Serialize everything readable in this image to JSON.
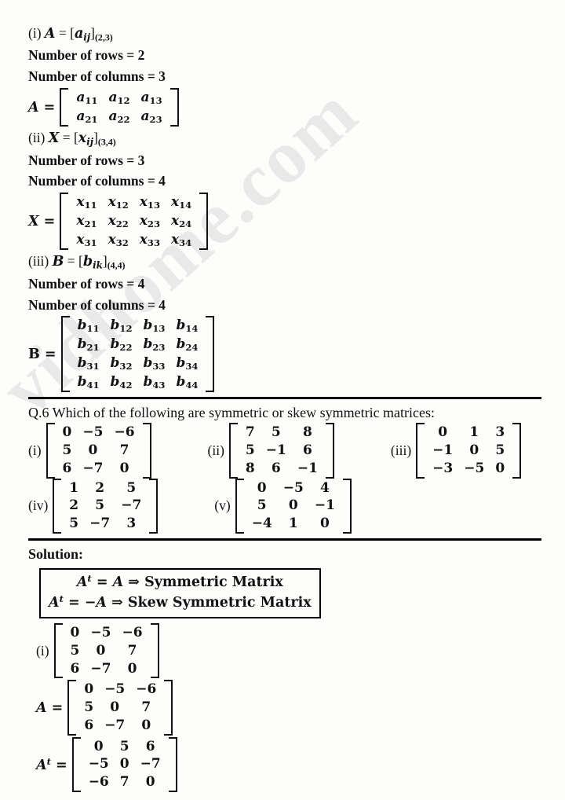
{
  "document": {
    "type": "math-worksheet-page",
    "watermark_text": "vidhome.com"
  },
  "part_i": {
    "label": "(i)",
    "definition_var": "A",
    "definition_eq": "=",
    "entry_symbol": "a",
    "entry_sub": "ij",
    "order": "(2,3)",
    "rows_text": "Number of rows = 2",
    "cols_text": "Number of columns = 3",
    "matrix_label": "A",
    "matrix": {
      "rows": 2,
      "cols": 3,
      "cells": [
        [
          "a",
          "a",
          "a"
        ],
        [
          "a",
          "a",
          "a"
        ]
      ],
      "subs": [
        [
          "11",
          "12",
          "13"
        ],
        [
          "21",
          "22",
          "23"
        ]
      ]
    }
  },
  "part_ii": {
    "label": "(ii)",
    "definition_var": "X",
    "entry_symbol": "x",
    "entry_sub": "ij",
    "order": "(3,4)",
    "rows_text": "Number of rows = 3",
    "cols_text": "Number of columns = 4",
    "matrix_label": "X",
    "matrix": {
      "rows": 3,
      "cols": 4,
      "cells": [
        [
          "x",
          "x",
          "x",
          "x"
        ],
        [
          "x",
          "x",
          "x",
          "x"
        ],
        [
          "x",
          "x",
          "x",
          "x"
        ]
      ],
      "subs": [
        [
          "11",
          "12",
          "13",
          "14"
        ],
        [
          "21",
          "22",
          "23",
          "24"
        ],
        [
          "31",
          "32",
          "33",
          "34"
        ]
      ]
    }
  },
  "part_iii": {
    "label": "(iii)",
    "definition_var": "B",
    "entry_symbol": "b",
    "entry_sub": "ik",
    "order": "(4,4)",
    "rows_text": "Number of rows = 4",
    "cols_text": "Number of columns = 4",
    "matrix_label": "B",
    "matrix": {
      "rows": 4,
      "cols": 4,
      "cells": [
        [
          "b",
          "b",
          "b",
          "b"
        ],
        [
          "b",
          "b",
          "b",
          "b"
        ],
        [
          "b",
          "b",
          "b",
          "b"
        ],
        [
          "b",
          "b",
          "b",
          "b"
        ]
      ],
      "subs": [
        [
          "11",
          "12",
          "13",
          "14"
        ],
        [
          "21",
          "22",
          "23",
          "24"
        ],
        [
          "31",
          "32",
          "33",
          "34"
        ],
        [
          "41",
          "42",
          "43",
          "44"
        ]
      ]
    }
  },
  "question": {
    "number": "Q.6",
    "text": "Which of the following are symmetric or skew symmetric matrices:",
    "full_line": "Q.6 Which of the following are symmetric or skew symmetric matrices:",
    "matrices": [
      {
        "label": "(i)",
        "values": [
          [
            "0",
            "−5",
            "−6"
          ],
          [
            "5",
            "0",
            "7"
          ],
          [
            "6",
            "−7",
            "0"
          ]
        ]
      },
      {
        "label": "(ii)",
        "values": [
          [
            "7",
            "5",
            "8"
          ],
          [
            "5",
            "−1",
            "6"
          ],
          [
            "8",
            "6",
            "−1"
          ]
        ]
      },
      {
        "label": "(iii)",
        "values": [
          [
            "0",
            "1",
            "3"
          ],
          [
            "−1",
            "0",
            "5"
          ],
          [
            "−3",
            "−5",
            "0"
          ]
        ]
      },
      {
        "label": "(iv)",
        "values": [
          [
            "1",
            "2",
            "5"
          ],
          [
            "2",
            "5",
            "−7"
          ],
          [
            "5",
            "−7",
            "3"
          ]
        ]
      },
      {
        "label": "(v)",
        "values": [
          [
            "0",
            "−5",
            "4"
          ],
          [
            "5",
            "0",
            "−1"
          ],
          [
            "−4",
            "1",
            "0"
          ]
        ]
      }
    ]
  },
  "solution": {
    "heading": "Solution:",
    "rules": {
      "symmetric": {
        "lhs": "A",
        "sup": "t",
        "eq": "= A",
        "arrow": "⇒",
        "result": "Symmetric Matrix",
        "full": "Aᵗ = A ⇒ Symmetric Matrix"
      },
      "skew": {
        "lhs": "A",
        "sup": "t",
        "eq": "= −A",
        "arrow": "⇒",
        "result": "Skew Symmetric Matrix",
        "full": "Aᵗ = −A ⇒ Skew Symmetric Matrix"
      }
    },
    "part_i": {
      "label": "(i)",
      "given": [
        [
          "0",
          "−5",
          "−6"
        ],
        [
          "5",
          "0",
          "7"
        ],
        [
          "6",
          "−7",
          "0"
        ]
      ],
      "a_label": "A",
      "a_matrix": [
        [
          "0",
          "−5",
          "−6"
        ],
        [
          "5",
          "0",
          "7"
        ],
        [
          "6",
          "−7",
          "0"
        ]
      ],
      "at_label": "A",
      "at_sup": "t",
      "at_matrix": [
        [
          "0",
          "5",
          "6"
        ],
        [
          "−5",
          "0",
          "−7"
        ],
        [
          "−6",
          "7",
          "0"
        ]
      ]
    }
  }
}
